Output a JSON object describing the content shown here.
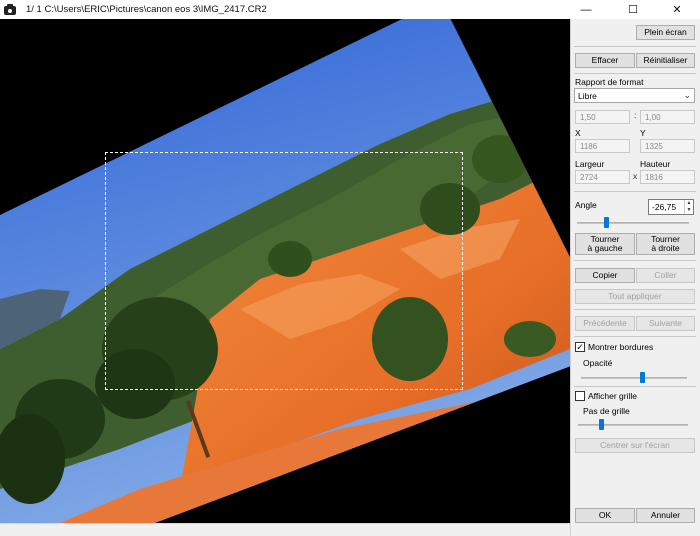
{
  "window": {
    "title": "1/  1  C:\\Users\\ERIC\\Pictures\\canon eos 3\\IMG_2417.CR2",
    "minimize": "—",
    "maximize": "☐",
    "close": "✕"
  },
  "panel": {
    "fullscreen": "Plein écran",
    "clear": "Effacer",
    "reset": "Réinitialiser",
    "ratio_label": "Rapport de format",
    "ratio_value": "Libre",
    "ratio_w": "1,50",
    "ratio_sep": ":",
    "ratio_h": "1,00",
    "x_label": "X",
    "x_value": "1186",
    "y_label": "Y",
    "y_value": "1325",
    "width_label": "Largeur",
    "width_value": "2724",
    "size_sep": "x",
    "height_label": "Hauteur",
    "height_value": "1816",
    "angle_label": "Angle",
    "angle_value": "-26,75",
    "rotate_left_1": "Tourner",
    "rotate_left_2": "à gauche",
    "rotate_right_1": "Tourner",
    "rotate_right_2": "à droite",
    "copy": "Copier",
    "paste": "Coller",
    "apply_all": "Tout appliquer",
    "previous": "Précédente",
    "next": "Suivante",
    "show_borders": "Montrer bordures",
    "show_borders_checked": true,
    "opacity_label": "Opacité",
    "show_grid": "Afficher grille",
    "show_grid_checked": false,
    "grid_step_label": "Pas de grille",
    "center_screen": "Centrer sur l'écran",
    "ok": "OK",
    "cancel": "Annuler"
  },
  "sliders": {
    "angle_position": 0.25,
    "opacity_position": 0.58,
    "grid_step_position": 0.2
  },
  "colors": {
    "accent": "#0078d7",
    "panel_bg": "#f0f0f0",
    "sky": "#3a70d8",
    "ochre": "#e8762e"
  }
}
